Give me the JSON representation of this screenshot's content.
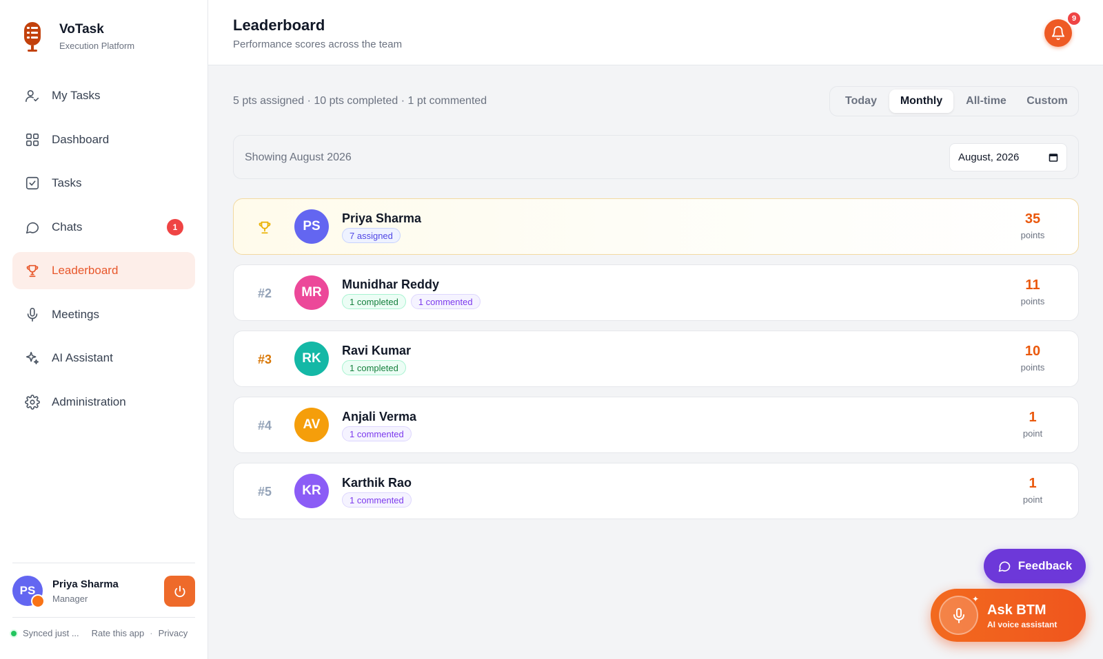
{
  "brand": {
    "name": "VoTask",
    "subtitle": "Execution Platform"
  },
  "sidebar": {
    "items": [
      {
        "label": "My Tasks",
        "icon": "user-check-icon"
      },
      {
        "label": "Dashboard",
        "icon": "grid-icon"
      },
      {
        "label": "Tasks",
        "icon": "checkbox-icon"
      },
      {
        "label": "Chats",
        "icon": "chat-icon",
        "badge": "1"
      },
      {
        "label": "Leaderboard",
        "icon": "trophy-icon",
        "active": true
      },
      {
        "label": "Meetings",
        "icon": "microphone-icon"
      },
      {
        "label": "AI Assistant",
        "icon": "sparkles-icon"
      },
      {
        "label": "Administration",
        "icon": "gear-icon"
      }
    ],
    "user": {
      "initials": "PS",
      "name": "Priya Sharma",
      "role": "Manager"
    },
    "footer": {
      "sync": "Synced just ...",
      "rate": "Rate this app",
      "separator": "·",
      "privacy": "Privacy"
    }
  },
  "header": {
    "title": "Leaderboard",
    "subtitle": "Performance scores across the team",
    "notifications": "9"
  },
  "summary": "5 pts assigned · 10 pts completed · 1 pt commented",
  "period_tabs": [
    {
      "label": "Today",
      "active": false
    },
    {
      "label": "Monthly",
      "active": true
    },
    {
      "label": "All-time",
      "active": false
    },
    {
      "label": "Custom",
      "active": false
    }
  ],
  "filter": {
    "showing": "Showing August 2026",
    "month_value": "August, 2026"
  },
  "leaderboard": [
    {
      "rank": "",
      "initials": "PS",
      "name": "Priya Sharma",
      "avatar_color": "#6366f1",
      "tags": [
        {
          "type": "assigned",
          "text": "7 assigned"
        }
      ],
      "points": "35",
      "unit": "points"
    },
    {
      "rank": "#2",
      "initials": "MR",
      "name": "Munidhar Reddy",
      "avatar_color": "#ec4899",
      "tags": [
        {
          "type": "completed",
          "text": "1 completed"
        },
        {
          "type": "commented",
          "text": "1 commented"
        }
      ],
      "points": "11",
      "unit": "points"
    },
    {
      "rank": "#3",
      "initials": "RK",
      "name": "Ravi Kumar",
      "avatar_color": "#14b8a6",
      "tags": [
        {
          "type": "completed",
          "text": "1 completed"
        }
      ],
      "points": "10",
      "unit": "points"
    },
    {
      "rank": "#4",
      "initials": "AV",
      "name": "Anjali Verma",
      "avatar_color": "#f59e0b",
      "tags": [
        {
          "type": "commented",
          "text": "1 commented"
        }
      ],
      "points": "1",
      "unit": "point"
    },
    {
      "rank": "#5",
      "initials": "KR",
      "name": "Karthik Rao",
      "avatar_color": "#8b5cf6",
      "tags": [
        {
          "type": "commented",
          "text": "1 commented"
        }
      ],
      "points": "1",
      "unit": "point"
    }
  ],
  "floating": {
    "feedback": "Feedback",
    "ask_title": "Ask BTM",
    "ask_sub": "AI voice assistant"
  },
  "colors": {
    "accent": "#e8572b",
    "points": "#ea580c",
    "feedback": "#6d38d9"
  }
}
